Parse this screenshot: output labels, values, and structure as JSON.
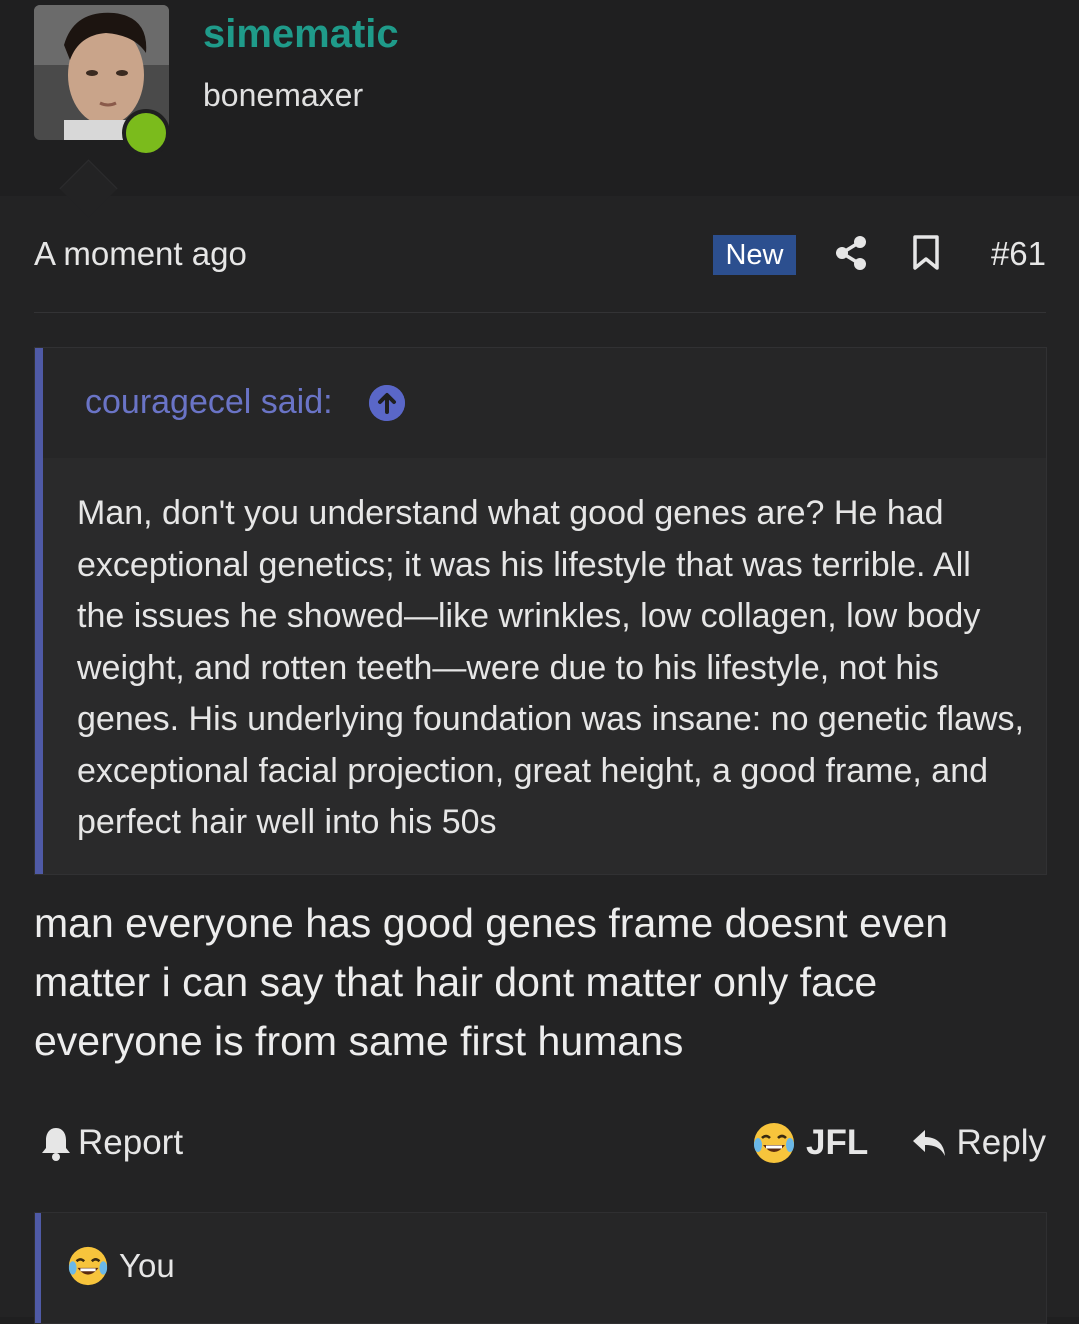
{
  "user": {
    "name": "simematic",
    "title": "bonemaxer",
    "online_color": "#7bbb1c"
  },
  "post": {
    "timestamp": "A moment ago",
    "badge": "New",
    "number": "#61",
    "quote": {
      "author": "couragecel said:",
      "body": "Man, don't you understand what good genes are? He had exceptional genetics; it was his lifestyle that was terrible. All the issues he showed—like wrinkles, low collagen, low body weight, and rotten teeth—were due to his lifestyle, not his genes. His underlying foundation was insane: no genetic flaws, exceptional facial projection, great height, a good frame, and perfect hair well into his 50s"
    },
    "text": "man everyone has good genes frame doesnt even matter i can say that hair dont matter only face everyone is from same first humans"
  },
  "actions": {
    "report": "Report",
    "reaction": "JFL",
    "reply": "Reply"
  },
  "reactions": {
    "label": "You"
  },
  "colors": {
    "accent": "#1f9b8a",
    "quote_bar": "#4f5aa6",
    "badge": "#2c4f8f"
  }
}
